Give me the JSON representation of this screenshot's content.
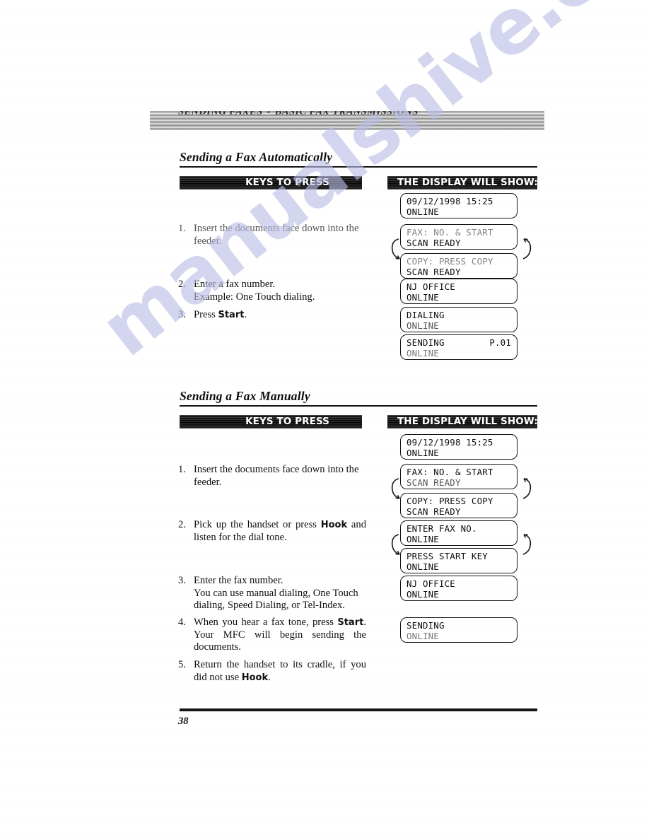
{
  "page": {
    "running_head": {
      "chapter": "SENDING FAXES",
      "separator": "-",
      "topic": "BASIC FAX TRANSMISSIONS"
    },
    "footer_page_number": "38",
    "watermark": "manualshive.com"
  },
  "column_headers": {
    "keys": "KEYS TO PRESS",
    "display": "THE DISPLAY WILL SHOW:"
  },
  "sections": [
    {
      "title": "Sending a Fax Automatically",
      "steps": [
        {
          "num": "1.",
          "text": "Insert the documents face down into the feeder."
        },
        {
          "num": "2.",
          "line1": "Enter a fax number.",
          "line2": "Example: One Touch dialing."
        },
        {
          "num": "3.",
          "pre": "Press ",
          "bold": "Start",
          "post": "."
        }
      ],
      "displays": [
        {
          "line1": "09/12/1998 15:25",
          "line2": "ONLINE"
        },
        {
          "line1": "FAX: NO. & START",
          "line2": "SCAN READY"
        },
        {
          "line1": "COPY: PRESS COPY",
          "line2": "SCAN READY"
        },
        {
          "line1": "NJ OFFICE",
          "line2": "ONLINE"
        },
        {
          "line1": "DIALING",
          "line2": "ONLINE"
        },
        {
          "line1": "SENDING",
          "line1_right": "P.01",
          "line2": "ONLINE"
        }
      ]
    },
    {
      "title": "Sending a Fax Manually",
      "steps": [
        {
          "num": "1.",
          "text": "Insert the documents face down into the feeder."
        },
        {
          "num": "2.",
          "pre": "Pick up the handset or press ",
          "bold": "Hook",
          "post": " and listen for the dial tone."
        },
        {
          "num": "3.",
          "line1": "Enter the fax number.",
          "line2": "You can use manual dialing, One Touch dialing, Speed Dialing, or Tel-Index."
        },
        {
          "num": "4.",
          "pre": "When you hear a fax tone, press ",
          "bold": "Start",
          "post": ". Your MFC will begin sending the documents."
        },
        {
          "num": "5.",
          "pre": "Return the handset to its cradle, if you did not use ",
          "bold": "Hook",
          "post": "."
        }
      ],
      "displays": [
        {
          "line1": "09/12/1998 15:25",
          "line2": "ONLINE"
        },
        {
          "line1": "FAX: NO. & START",
          "line2": "SCAN READY"
        },
        {
          "line1": "COPY: PRESS COPY",
          "line2": "SCAN READY"
        },
        {
          "line1": "ENTER FAX NO.",
          "line2": "ONLINE"
        },
        {
          "line1": "PRESS START KEY",
          "line2": "ONLINE"
        },
        {
          "line1": "NJ OFFICE",
          "line2": "ONLINE"
        },
        {
          "line1": "SENDING",
          "line2": "ONLINE"
        }
      ]
    }
  ]
}
